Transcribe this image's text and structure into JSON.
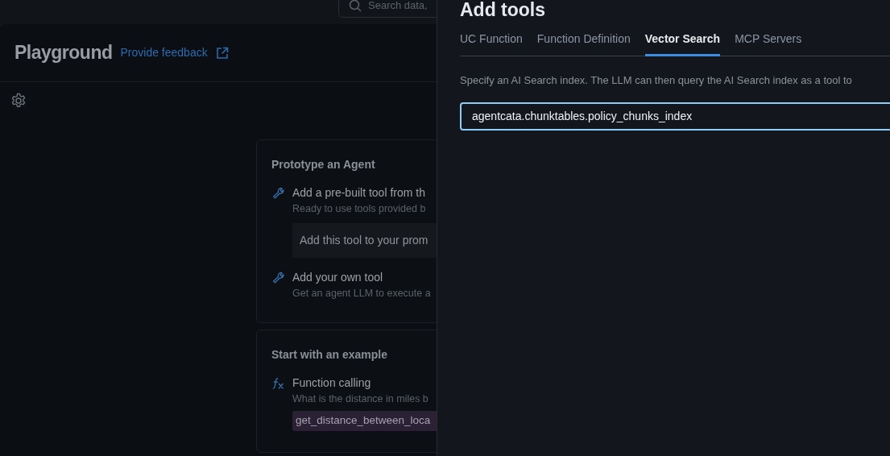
{
  "search": {
    "placeholder": "Search data,"
  },
  "page": {
    "title": "Playground",
    "feedback_link": "Provide feedback"
  },
  "cards": [
    {
      "title": "Prototype an Agent",
      "items": [
        {
          "kind": "tool",
          "title": "Add a pre-built tool from th",
          "subtitle": "Ready to use tools provided b",
          "action": "Add this tool to your prom"
        },
        {
          "kind": "tool",
          "title": "Add your own tool",
          "subtitle": "Get an agent LLM to execute a"
        }
      ]
    },
    {
      "title": "Start with an example",
      "items": [
        {
          "kind": "function",
          "title": "Function calling",
          "subtitle": "What is the distance in miles b",
          "code": "get_distance_between_loca"
        }
      ]
    }
  ],
  "drawer": {
    "title": "Add tools",
    "tabs": [
      {
        "label": "UC Function",
        "selected": false
      },
      {
        "label": "Function Definition",
        "selected": false
      },
      {
        "label": "Vector Search",
        "selected": true
      },
      {
        "label": "MCP Servers",
        "selected": false
      }
    ],
    "description": "Specify an AI Search index. The LLM can then query the AI Search index as a tool to",
    "index_field": {
      "value": "agentcata.chunktables.policy_chunks_index",
      "focused": true
    }
  }
}
